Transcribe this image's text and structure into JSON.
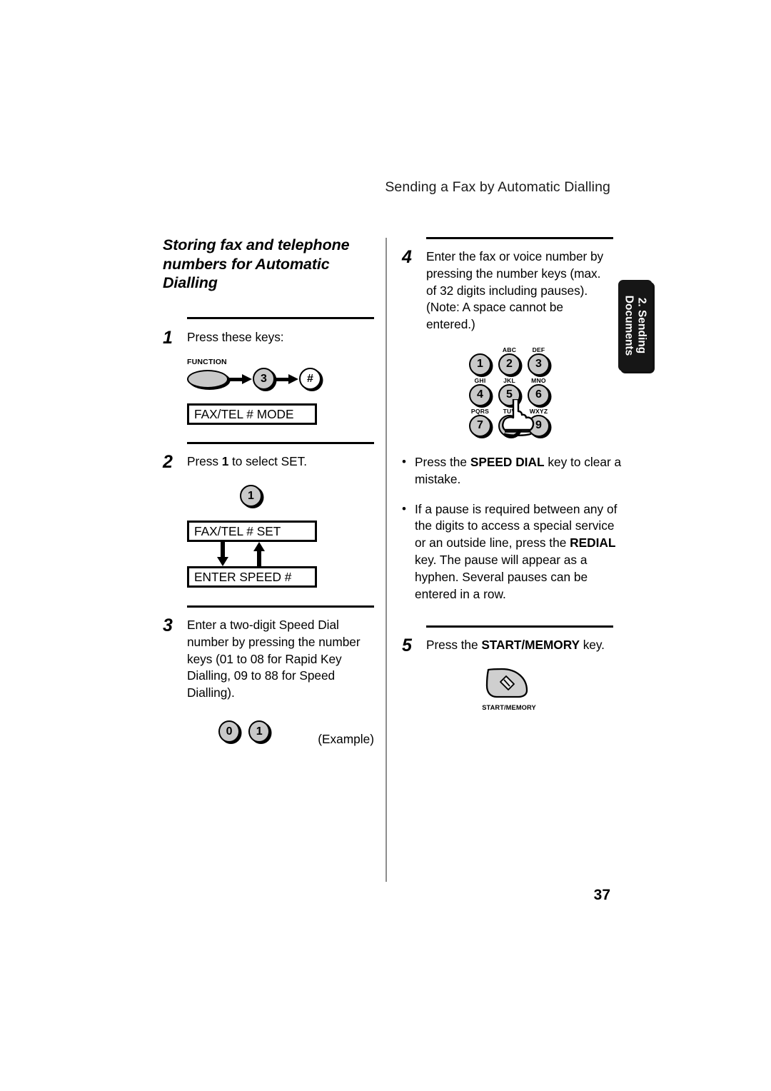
{
  "header": {
    "running_title": "Sending a Fax by Automatic Dialling"
  },
  "section": {
    "heading": "Storing fax and telephone numbers for Automatic Dialling"
  },
  "left_column": {
    "steps": [
      {
        "number": "1",
        "text": "Press these keys:",
        "function_key_caption": "FUNCTION",
        "key_3": "3",
        "key_hash": "#",
        "lcd": "FAX/TEL # MODE"
      },
      {
        "number": "2",
        "text_before": "Press ",
        "text_bold": "1",
        "text_after": " to select SET.",
        "key_1": "1",
        "lcd_top": "FAX/TEL # SET",
        "lcd_bottom": "ENTER SPEED #"
      },
      {
        "number": "3",
        "text": "Enter a two-digit Speed Dial number by pressing the number keys (01 to 08 for Rapid Key Dialling, 09 to 88 for Speed Dialling).",
        "key_0": "0",
        "key_1": "1",
        "example_label": "(Example)"
      }
    ]
  },
  "right_column": {
    "steps": [
      {
        "number": "4",
        "text": "Enter the fax or voice number by pressing the number keys (max. of 32 digits including pauses). (Note: A space cannot be entered.)"
      },
      {
        "number": "5",
        "text_before": "Press the ",
        "text_bold": "START/MEMORY",
        "text_after": " key.",
        "start_key_label": "START/MEMORY"
      }
    ],
    "keypad": {
      "keys": [
        {
          "digit": "1",
          "letters": ""
        },
        {
          "digit": "2",
          "letters": "ABC"
        },
        {
          "digit": "3",
          "letters": "DEF"
        },
        {
          "digit": "4",
          "letters": "GHI"
        },
        {
          "digit": "5",
          "letters": "JKL"
        },
        {
          "digit": "6",
          "letters": "MNO"
        },
        {
          "digit": "7",
          "letters": "PQRS"
        },
        {
          "digit": "8",
          "letters": "TUV"
        },
        {
          "digit": "9",
          "letters": "WXYZ"
        }
      ]
    },
    "bullets": [
      {
        "text_before": "Press the ",
        "text_bold": "SPEED DIAL",
        "text_after": " key to clear a mistake."
      },
      {
        "text_before": "If a pause is required between any of the digits to access a special service or an outside line, press the ",
        "text_bold": "REDIAL",
        "text_after": " key. The pause will appear as a hyphen. Several pauses can be entered in a row."
      }
    ]
  },
  "side_tab": {
    "line1": "2. Sending",
    "line2": "Documents"
  },
  "footer": {
    "page_number": "37"
  }
}
